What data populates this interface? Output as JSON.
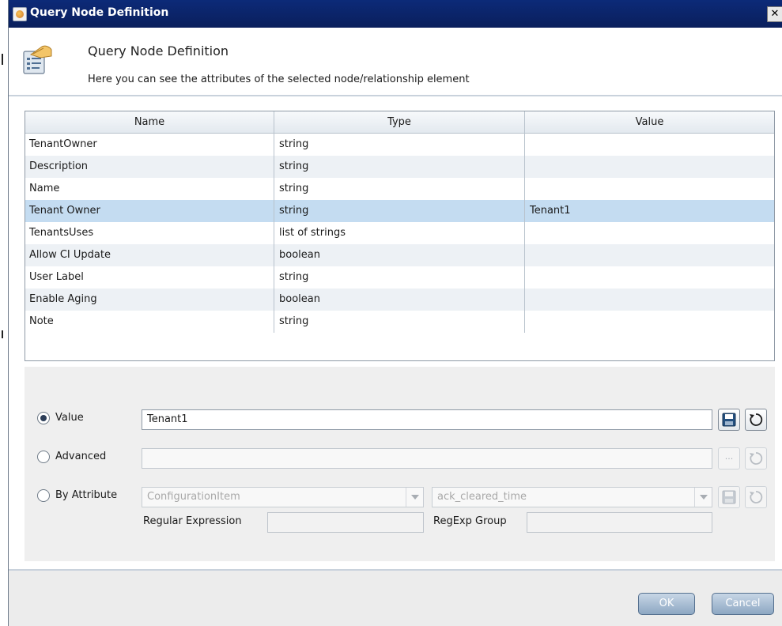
{
  "window": {
    "title": "Query Node Definition",
    "close_glyph": "✕"
  },
  "header": {
    "title": "Query Node Definition",
    "subtitle": "Here you can see the attributes of the selected node/relationship element",
    "icon": "document-hand-icon"
  },
  "table": {
    "columns": [
      "Name",
      "Type",
      "Value"
    ],
    "rows": [
      {
        "name": "TenantOwner",
        "type": "string",
        "value": ""
      },
      {
        "name": "Description",
        "type": "string",
        "value": ""
      },
      {
        "name": "Name",
        "type": "string",
        "value": ""
      },
      {
        "name": "Tenant Owner",
        "type": "string",
        "value": "Tenant1"
      },
      {
        "name": "TenantsUses",
        "type": "list of strings",
        "value": ""
      },
      {
        "name": "Allow CI Update",
        "type": "boolean",
        "value": ""
      },
      {
        "name": "User Label",
        "type": "string",
        "value": ""
      },
      {
        "name": "Enable Aging",
        "type": "boolean",
        "value": ""
      },
      {
        "name": "Note",
        "type": "string",
        "value": ""
      }
    ],
    "selected_row": 3
  },
  "form": {
    "value_label": "Value",
    "value_text": "Tenant1",
    "advanced_label": "Advanced",
    "advanced_text": "",
    "by_attribute_label": "By Attribute",
    "ci_type": "ConfigurationItem",
    "attribute": "ack_cleared_time",
    "regex_label": "Regular Expression",
    "regexp_group_label": "RegExp Group",
    "browse_glyph": "...",
    "selected_option": "Value"
  },
  "footer": {
    "ok_label": "OK",
    "cancel_label": "Cancel"
  }
}
